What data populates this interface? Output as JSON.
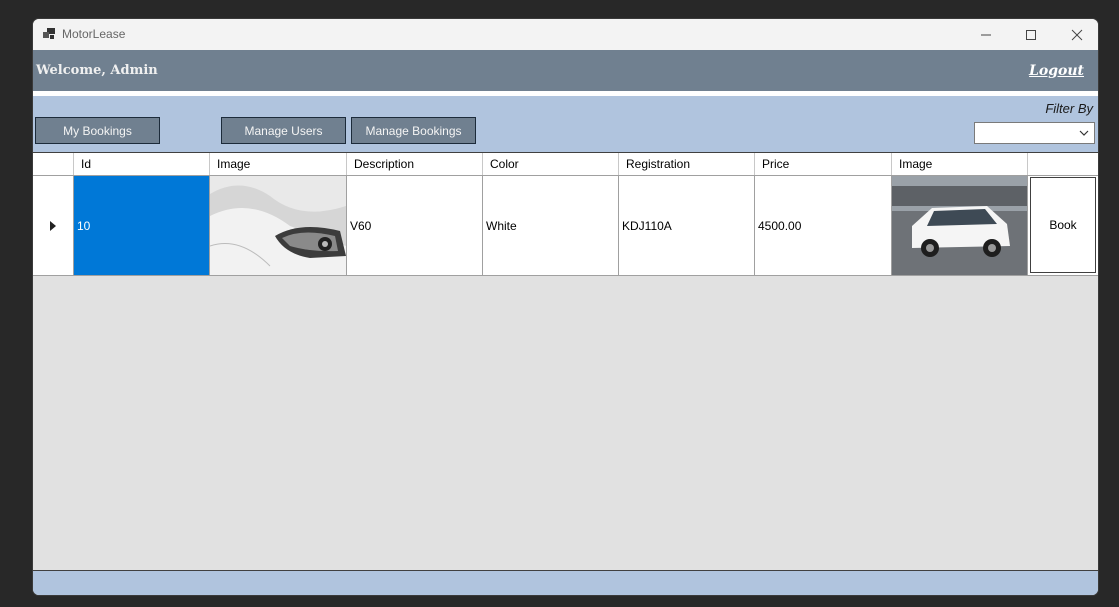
{
  "window": {
    "title": "MotorLease"
  },
  "header": {
    "welcome": "Welcome, Admin",
    "logout": "Logout"
  },
  "toolbar": {
    "my_bookings": "My Bookings",
    "manage_users": "Manage Users",
    "manage_bookings": "Manage Bookings",
    "filter_label": "Filter By",
    "filter_value": ""
  },
  "grid": {
    "columns": [
      "Id",
      "Image",
      "Description",
      "Color",
      "Registration",
      "Price",
      "Image",
      ""
    ],
    "rows": [
      {
        "id": "10",
        "description": "V60",
        "color": "White",
        "registration": "KDJ110A",
        "price": "4500.00",
        "action": "Book"
      }
    ]
  },
  "colors": {
    "header_bg": "#708090",
    "toolbar_bg": "#b0c4de",
    "selection": "#0078d7",
    "grid_bg": "#e1e1e1"
  }
}
